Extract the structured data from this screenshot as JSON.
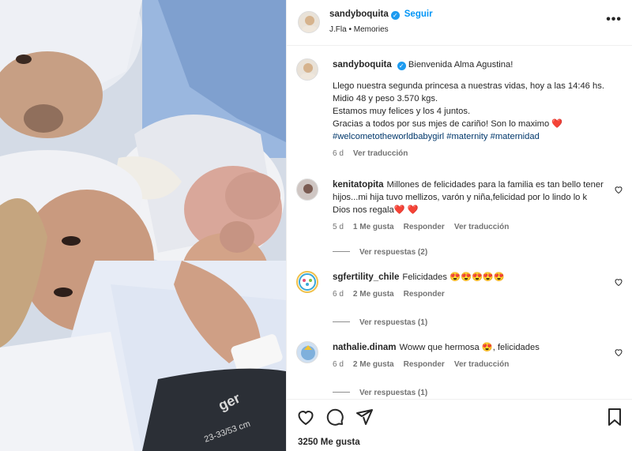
{
  "post": {
    "author": "sandyboquita",
    "follow_label": "Seguir",
    "location": "J.Fla",
    "separator": "•",
    "audio": "Memories",
    "more_glyph": "•••"
  },
  "caption": {
    "author": "sandyboquita",
    "line1": "Bienvenida Alma Agustina!",
    "line2": "Llego nuestra segunda princesa a nuestras vidas, hoy a las 14:46 hs. Midio 48 y peso 3.570 kgs.",
    "line3": "Estamos muy felices y los 4 juntos.",
    "line4": "Gracias a todos por sus mjes de cariño! Son lo maximo",
    "hashtags": "#welcometotheworldbabygirl #maternity #maternidad",
    "time": "6 d",
    "translate": "Ver traducción"
  },
  "comments": [
    {
      "user": "kenitatopita",
      "text": "Millones de felicidades para la familia es tan bello tener hijos...mi hija tuvo mellizos, varón y niña,felicidad por lo lindo lo k Dios nos regala",
      "emoji": "❤️ ❤️",
      "time": "5 d",
      "likes": "1 Me gusta",
      "reply": "Responder",
      "translate": "Ver traducción",
      "replies": "Ver respuestas (2)"
    },
    {
      "user": "sgfertility_chile",
      "text": "Felicidades",
      "emoji": "😍😍😍😍😍",
      "time": "6 d",
      "likes": "2 Me gusta",
      "reply": "Responder",
      "replies": "Ver respuestas (1)"
    },
    {
      "user": "nathalie.dinam",
      "text": "Woww que hermosa",
      "emoji": "😍",
      "text_after": ", felicidades",
      "time": "6 d",
      "likes": "2 Me gusta",
      "reply": "Responder",
      "translate": "Ver traducción",
      "replies": "Ver respuestas (1)"
    }
  ],
  "footer": {
    "likes": "3250 Me gusta"
  },
  "photo": {
    "wristband_text": "23-33/53 cm",
    "bag_text": "ger"
  },
  "colors": {
    "accent": "#0095f6",
    "verified": "#1d9bf0",
    "hashtag": "#00376b",
    "heart": "#e0245e"
  }
}
